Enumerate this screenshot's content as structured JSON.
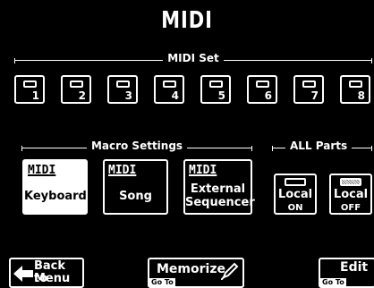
{
  "title": "MIDI",
  "midi_set": {
    "label": "MIDI Set",
    "buttons": [
      "1",
      "2",
      "3",
      "4",
      "5",
      "6",
      "7",
      "8"
    ]
  },
  "macro_settings": {
    "label": "Macro Settings",
    "logo_text": "MIDI",
    "buttons": [
      {
        "line1": "Keyboard",
        "line2": "",
        "active": true
      },
      {
        "line1": "Song",
        "line2": "",
        "active": false
      },
      {
        "line1": "External",
        "line2": "Sequencer",
        "active": false
      }
    ]
  },
  "all_parts": {
    "label": "ALL Parts",
    "buttons": [
      {
        "line1": "Local",
        "line2": "ON",
        "led_on": false
      },
      {
        "line1": "Local",
        "line2": "OFF",
        "led_on": true
      }
    ]
  },
  "footer": {
    "back_line1": "Back to",
    "back_line2": "Menu",
    "memorize": "Memorize",
    "memorize_goto": "Go To",
    "edit": "Edit",
    "edit_goto": "Go To"
  }
}
